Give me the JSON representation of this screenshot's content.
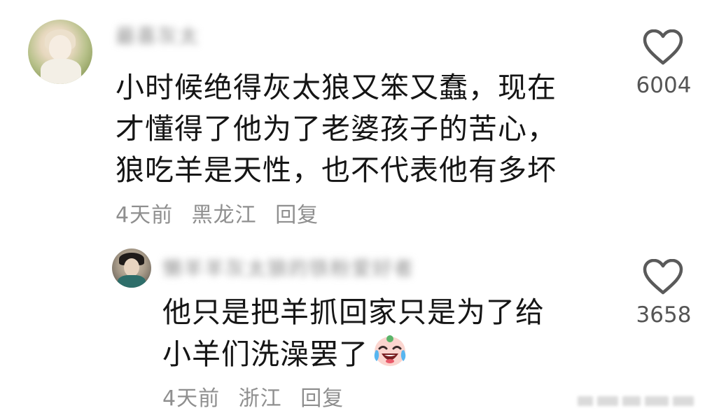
{
  "comments": [
    {
      "username": "最喜灰太",
      "text_lines": [
        "小时候绝得灰太狼又笨又蠢，现在",
        "才懂得了他为了老婆孩子的苦心，",
        "狼吃羊是天性，也不代表他有多坏"
      ],
      "time": "4天前",
      "location": "黑龙江",
      "reply_label": "回复",
      "likes": "6004",
      "icons": [
        "heart-outline-icon"
      ]
    },
    {
      "username": "懒羊羊灰太狼的铁粉爱好者",
      "text_lines": [
        "他只是把羊抓回家只是为了给",
        "小羊们洗澡罢了"
      ],
      "emoji": "crying-laugh-face-icon",
      "time": "4天前",
      "location": "浙江",
      "reply_label": "回复",
      "likes": "3658",
      "icons": [
        "heart-outline-icon"
      ]
    }
  ],
  "colors": {
    "text": "#151515",
    "meta": "#8f8f8f",
    "likes": "#555555",
    "background": "#ffffff"
  }
}
